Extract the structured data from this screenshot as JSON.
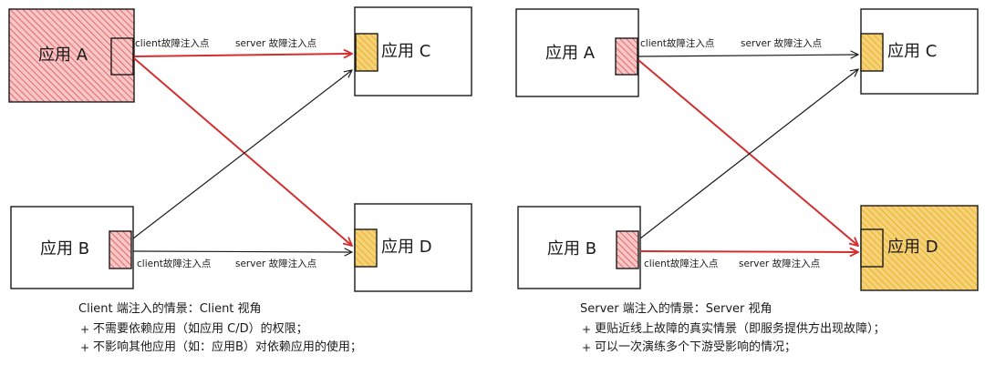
{
  "colors": {
    "red": "#d32f2f",
    "red_fill": "#f7c7c7",
    "red_hatch": "#e05050",
    "yellow_fill": "#f6d277",
    "yellow_hatch": "#e8a91c",
    "stroke": "#1a1a1a"
  },
  "left": {
    "boxes": {
      "a": "应用 A",
      "b": "应用 B",
      "c": "应用 C",
      "d": "应用 D"
    },
    "labels": {
      "a_client": "client故障注入点",
      "c_server": "server 故障注入点",
      "b_client": "client故障注入点",
      "d_server": "server 故障注入点"
    },
    "notes": {
      "title": "Client 端注入的情景：Client 视角",
      "items": [
        "不需要依赖应用（如应用 C/D）的权限；",
        "不影响其他应用（如：应用B）对依赖应用的使用；"
      ]
    }
  },
  "right": {
    "boxes": {
      "a": "应用 A",
      "b": "应用 B",
      "c": "应用 C",
      "d": "应用 D"
    },
    "labels": {
      "a_client": "client故障注入点",
      "c_server": "server 故障注入点",
      "b_client": "client故障注入点",
      "d_server": "server 故障注入点"
    },
    "notes": {
      "title": "Server 端注入的情景：Server 视角",
      "items": [
        "更贴近线上故障的真实情景（即服务提供方出现故障）；",
        "可以一次演练多个下游受影响的情况；"
      ]
    }
  }
}
